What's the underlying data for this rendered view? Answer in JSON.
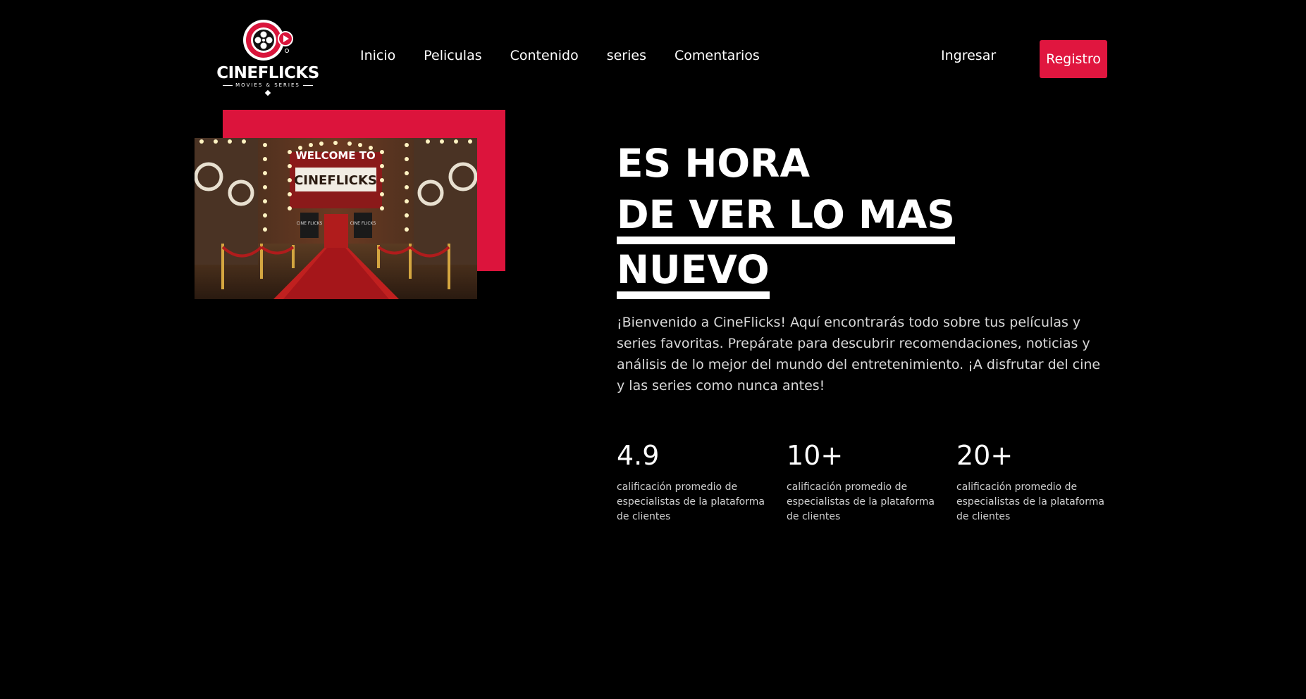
{
  "brand": {
    "name": "CINEFLICKS",
    "tagline": "MOVIES & SERIES",
    "logo_icon": "film-reel-play-icon",
    "accent_color": "#dc143c"
  },
  "nav": {
    "items": [
      {
        "label": "Inicio"
      },
      {
        "label": "Peliculas"
      },
      {
        "label": "Contenido"
      },
      {
        "label": "series"
      },
      {
        "label": "Comentarios"
      }
    ],
    "login_label": "Ingresar",
    "register_label": "Registro"
  },
  "hero": {
    "image_text_top": "WELCOME TO",
    "image_text_main": "CINEFLICKS",
    "image_sign_left": "CINE FLICKS",
    "image_sign_right": "CINE FLICKS",
    "headline_line1": "ES HORA",
    "headline_line2": "DE VER LO MAS",
    "headline_line3": "NUEVO",
    "intro": "¡Bienvenido a CineFlicks! Aquí encontrarás todo sobre tus películas y series favoritas. Prepárate para descubrir recomendaciones, noticias y análisis de lo mejor del mundo del entretenimiento. ¡A disfrutar del cine y las series como nunca antes!"
  },
  "stats": [
    {
      "value": "4.9",
      "description": "calificación promedio de especialistas de la plataforma de clientes"
    },
    {
      "value": "10+",
      "description": "calificación promedio de especialistas de la plataforma de clientes"
    },
    {
      "value": "20+",
      "description": "calificación promedio de especialistas de la plataforma de clientes"
    }
  ]
}
